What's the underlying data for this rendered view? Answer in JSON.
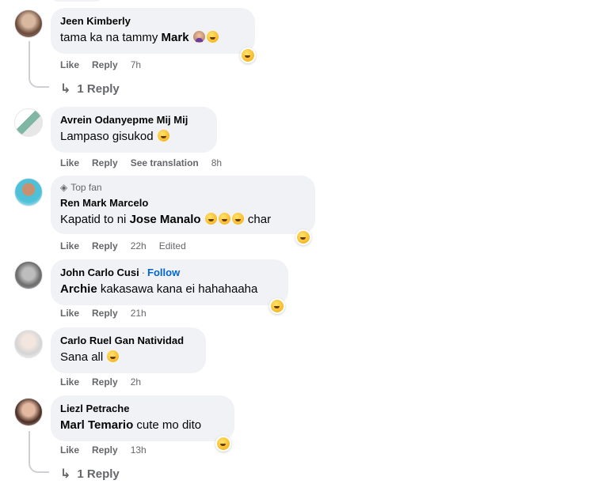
{
  "comments": [
    {
      "author": "Jeen Kimberly",
      "text_plain": "tama ka na tammy ",
      "mention": "Mark",
      "actions": {
        "like": "Like",
        "reply": "Reply",
        "time": "7h"
      },
      "replies": "1 Reply"
    },
    {
      "author": "Avrein Odanyepme Mij Mij",
      "text_plain": "Lampaso gisukod ",
      "actions": {
        "like": "Like",
        "reply": "Reply",
        "translate": "See translation",
        "time": "8h"
      }
    },
    {
      "badge": "Top fan",
      "author": "Ren Mark Marcelo",
      "text_prefix": "Kapatid to ni ",
      "mention": "Jose Manalo",
      "text_suffix": " char",
      "actions": {
        "like": "Like",
        "reply": "Reply",
        "time": "22h",
        "edited": "Edited"
      }
    },
    {
      "author": "John Carlo Cusi",
      "follow": "Follow",
      "mention": "Archie",
      "text_suffix": " kakasawa kana ei hahahaaha",
      "actions": {
        "like": "Like",
        "reply": "Reply",
        "time": "21h"
      }
    },
    {
      "author": "Carlo Ruel Gan Natividad",
      "text_plain": "Sana all ",
      "actions": {
        "like": "Like",
        "reply": "Reply",
        "time": "2h"
      }
    },
    {
      "author": "Liezl Petrache",
      "mention": "Marl Temario",
      "text_suffix": " cute mo dito",
      "actions": {
        "like": "Like",
        "reply": "Reply",
        "time": "13h"
      },
      "replies": "1 Reply"
    }
  ],
  "icons": {
    "reaction": "haha-emoji-icon",
    "reply_arrow": "reply-arrow-icon",
    "top_fan": "diamond-icon"
  }
}
